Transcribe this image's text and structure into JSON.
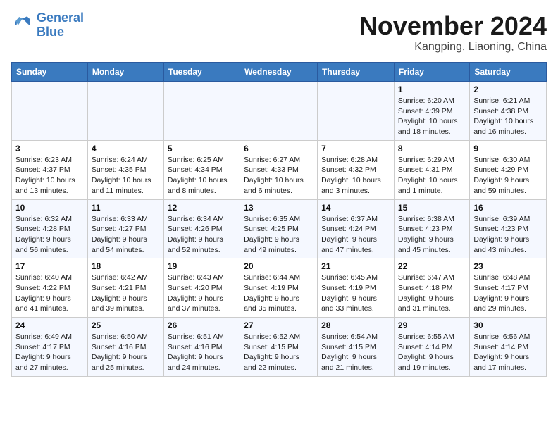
{
  "logo": {
    "line1": "General",
    "line2": "Blue"
  },
  "title": "November 2024",
  "location": "Kangping, Liaoning, China",
  "weekdays": [
    "Sunday",
    "Monday",
    "Tuesday",
    "Wednesday",
    "Thursday",
    "Friday",
    "Saturday"
  ],
  "weeks": [
    [
      {
        "day": "",
        "sunrise": "",
        "sunset": "",
        "daylight": ""
      },
      {
        "day": "",
        "sunrise": "",
        "sunset": "",
        "daylight": ""
      },
      {
        "day": "",
        "sunrise": "",
        "sunset": "",
        "daylight": ""
      },
      {
        "day": "",
        "sunrise": "",
        "sunset": "",
        "daylight": ""
      },
      {
        "day": "",
        "sunrise": "",
        "sunset": "",
        "daylight": ""
      },
      {
        "day": "1",
        "sunrise": "Sunrise: 6:20 AM",
        "sunset": "Sunset: 4:39 PM",
        "daylight": "Daylight: 10 hours and 18 minutes."
      },
      {
        "day": "2",
        "sunrise": "Sunrise: 6:21 AM",
        "sunset": "Sunset: 4:38 PM",
        "daylight": "Daylight: 10 hours and 16 minutes."
      }
    ],
    [
      {
        "day": "3",
        "sunrise": "Sunrise: 6:23 AM",
        "sunset": "Sunset: 4:37 PM",
        "daylight": "Daylight: 10 hours and 13 minutes."
      },
      {
        "day": "4",
        "sunrise": "Sunrise: 6:24 AM",
        "sunset": "Sunset: 4:35 PM",
        "daylight": "Daylight: 10 hours and 11 minutes."
      },
      {
        "day": "5",
        "sunrise": "Sunrise: 6:25 AM",
        "sunset": "Sunset: 4:34 PM",
        "daylight": "Daylight: 10 hours and 8 minutes."
      },
      {
        "day": "6",
        "sunrise": "Sunrise: 6:27 AM",
        "sunset": "Sunset: 4:33 PM",
        "daylight": "Daylight: 10 hours and 6 minutes."
      },
      {
        "day": "7",
        "sunrise": "Sunrise: 6:28 AM",
        "sunset": "Sunset: 4:32 PM",
        "daylight": "Daylight: 10 hours and 3 minutes."
      },
      {
        "day": "8",
        "sunrise": "Sunrise: 6:29 AM",
        "sunset": "Sunset: 4:31 PM",
        "daylight": "Daylight: 10 hours and 1 minute."
      },
      {
        "day": "9",
        "sunrise": "Sunrise: 6:30 AM",
        "sunset": "Sunset: 4:29 PM",
        "daylight": "Daylight: 9 hours and 59 minutes."
      }
    ],
    [
      {
        "day": "10",
        "sunrise": "Sunrise: 6:32 AM",
        "sunset": "Sunset: 4:28 PM",
        "daylight": "Daylight: 9 hours and 56 minutes."
      },
      {
        "day": "11",
        "sunrise": "Sunrise: 6:33 AM",
        "sunset": "Sunset: 4:27 PM",
        "daylight": "Daylight: 9 hours and 54 minutes."
      },
      {
        "day": "12",
        "sunrise": "Sunrise: 6:34 AM",
        "sunset": "Sunset: 4:26 PM",
        "daylight": "Daylight: 9 hours and 52 minutes."
      },
      {
        "day": "13",
        "sunrise": "Sunrise: 6:35 AM",
        "sunset": "Sunset: 4:25 PM",
        "daylight": "Daylight: 9 hours and 49 minutes."
      },
      {
        "day": "14",
        "sunrise": "Sunrise: 6:37 AM",
        "sunset": "Sunset: 4:24 PM",
        "daylight": "Daylight: 9 hours and 47 minutes."
      },
      {
        "day": "15",
        "sunrise": "Sunrise: 6:38 AM",
        "sunset": "Sunset: 4:23 PM",
        "daylight": "Daylight: 9 hours and 45 minutes."
      },
      {
        "day": "16",
        "sunrise": "Sunrise: 6:39 AM",
        "sunset": "Sunset: 4:23 PM",
        "daylight": "Daylight: 9 hours and 43 minutes."
      }
    ],
    [
      {
        "day": "17",
        "sunrise": "Sunrise: 6:40 AM",
        "sunset": "Sunset: 4:22 PM",
        "daylight": "Daylight: 9 hours and 41 minutes."
      },
      {
        "day": "18",
        "sunrise": "Sunrise: 6:42 AM",
        "sunset": "Sunset: 4:21 PM",
        "daylight": "Daylight: 9 hours and 39 minutes."
      },
      {
        "day": "19",
        "sunrise": "Sunrise: 6:43 AM",
        "sunset": "Sunset: 4:20 PM",
        "daylight": "Daylight: 9 hours and 37 minutes."
      },
      {
        "day": "20",
        "sunrise": "Sunrise: 6:44 AM",
        "sunset": "Sunset: 4:19 PM",
        "daylight": "Daylight: 9 hours and 35 minutes."
      },
      {
        "day": "21",
        "sunrise": "Sunrise: 6:45 AM",
        "sunset": "Sunset: 4:19 PM",
        "daylight": "Daylight: 9 hours and 33 minutes."
      },
      {
        "day": "22",
        "sunrise": "Sunrise: 6:47 AM",
        "sunset": "Sunset: 4:18 PM",
        "daylight": "Daylight: 9 hours and 31 minutes."
      },
      {
        "day": "23",
        "sunrise": "Sunrise: 6:48 AM",
        "sunset": "Sunset: 4:17 PM",
        "daylight": "Daylight: 9 hours and 29 minutes."
      }
    ],
    [
      {
        "day": "24",
        "sunrise": "Sunrise: 6:49 AM",
        "sunset": "Sunset: 4:17 PM",
        "daylight": "Daylight: 9 hours and 27 minutes."
      },
      {
        "day": "25",
        "sunrise": "Sunrise: 6:50 AM",
        "sunset": "Sunset: 4:16 PM",
        "daylight": "Daylight: 9 hours and 25 minutes."
      },
      {
        "day": "26",
        "sunrise": "Sunrise: 6:51 AM",
        "sunset": "Sunset: 4:16 PM",
        "daylight": "Daylight: 9 hours and 24 minutes."
      },
      {
        "day": "27",
        "sunrise": "Sunrise: 6:52 AM",
        "sunset": "Sunset: 4:15 PM",
        "daylight": "Daylight: 9 hours and 22 minutes."
      },
      {
        "day": "28",
        "sunrise": "Sunrise: 6:54 AM",
        "sunset": "Sunset: 4:15 PM",
        "daylight": "Daylight: 9 hours and 21 minutes."
      },
      {
        "day": "29",
        "sunrise": "Sunrise: 6:55 AM",
        "sunset": "Sunset: 4:14 PM",
        "daylight": "Daylight: 9 hours and 19 minutes."
      },
      {
        "day": "30",
        "sunrise": "Sunrise: 6:56 AM",
        "sunset": "Sunset: 4:14 PM",
        "daylight": "Daylight: 9 hours and 17 minutes."
      }
    ]
  ]
}
